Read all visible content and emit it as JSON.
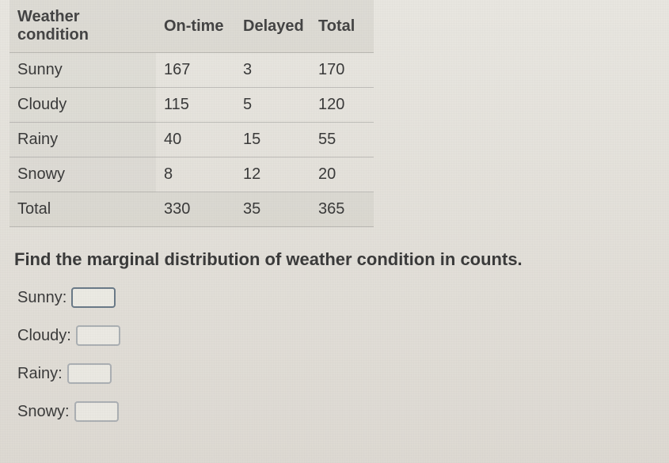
{
  "chart_data": {
    "type": "table",
    "title": "",
    "columns": [
      "Weather condition",
      "On-time",
      "Delayed",
      "Total"
    ],
    "rows": [
      {
        "label": "Sunny",
        "on_time": 167,
        "delayed": 3,
        "total": 170
      },
      {
        "label": "Cloudy",
        "on_time": 115,
        "delayed": 5,
        "total": 120
      },
      {
        "label": "Rainy",
        "on_time": 40,
        "delayed": 15,
        "total": 55
      },
      {
        "label": "Snowy",
        "on_time": 8,
        "delayed": 12,
        "total": 20
      },
      {
        "label": "Total",
        "on_time": 330,
        "delayed": 35,
        "total": 365
      }
    ]
  },
  "table": {
    "headers": {
      "weather": "Weather condition",
      "ontime": "On-time",
      "delayed": "Delayed",
      "total": "Total"
    },
    "rows": [
      {
        "weather": "Sunny",
        "ontime": "167",
        "delayed": "3",
        "total": "170"
      },
      {
        "weather": "Cloudy",
        "ontime": "115",
        "delayed": "5",
        "total": "120"
      },
      {
        "weather": "Rainy",
        "ontime": "40",
        "delayed": "15",
        "total": "55"
      },
      {
        "weather": "Snowy",
        "ontime": "8",
        "delayed": "12",
        "total": "20"
      },
      {
        "weather": "Total",
        "ontime": "330",
        "delayed": "35",
        "total": "365"
      }
    ]
  },
  "prompt": "Find the marginal distribution of weather condition in counts.",
  "answers": {
    "sunny_label": "Sunny:",
    "cloudy_label": "Cloudy:",
    "rainy_label": "Rainy:",
    "snowy_label": "Snowy:",
    "sunny_value": "",
    "cloudy_value": "",
    "rainy_value": "",
    "snowy_value": ""
  }
}
